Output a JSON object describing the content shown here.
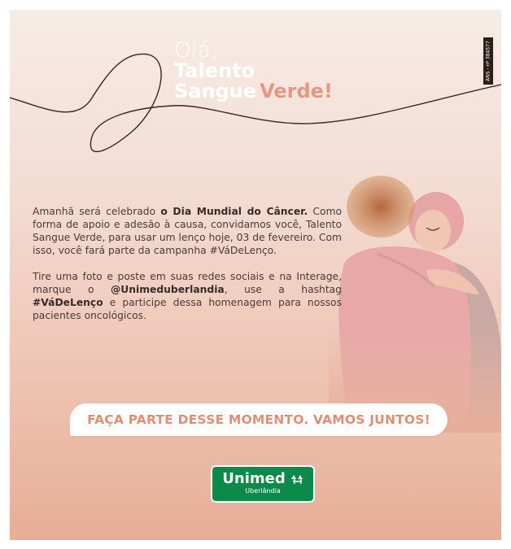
{
  "headline": {
    "line1": "Olá,",
    "line2": "Talento",
    "line3_a": "Sangue",
    "line3_b": "Verde!"
  },
  "ans_badge": "ANS - nº 384577",
  "body": {
    "p1_a": "Amanhã será celebrado ",
    "p1_bold": "o Dia Mundial do Câncer.",
    "p1_b": " Como forma de apoio e adesão à causa, convidamos você, Talento Sangue Verde, para usar um lenço hoje, 03 de fevereiro. Com isso, você fará parte da campanha #VáDeLenço.",
    "p2_a": "Tire uma foto e poste em suas redes sociais e na Interage, marque o ",
    "p2_bold1": "@Unimeduberlandia",
    "p2_b": ", use a hashtag ",
    "p2_bold2": "#VáDeLenço",
    "p2_c": " e participe dessa homenagem para nossos pacientes oncológicos."
  },
  "cta_text": "FAÇA PARTE DESSE MOMENTO. VAMOS JUNTOS!",
  "logo": {
    "brand": "Unimed",
    "city": "Uberlândia"
  },
  "colors": {
    "accent": "#e4987f",
    "brand_green": "#0b8a4a",
    "text": "#4a3a36"
  }
}
